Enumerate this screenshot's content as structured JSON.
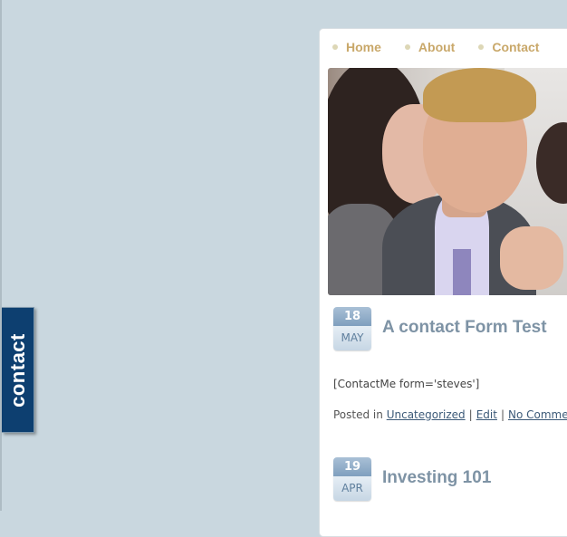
{
  "contact_tab": {
    "label": "contact"
  },
  "nav": {
    "items": [
      {
        "label": "Home"
      },
      {
        "label": "About"
      },
      {
        "label": "Contact"
      }
    ]
  },
  "posts": [
    {
      "day": "18",
      "month": "MAY",
      "title": "A contact Form Test",
      "body": "[ContactMe form='steves']",
      "posted_in": "Posted in",
      "category": "Uncategorized",
      "edit": "Edit",
      "comments": "No Comments"
    },
    {
      "day": "19",
      "month": "APR",
      "title": "Investing 101"
    }
  ],
  "colors": {
    "background": "#c9d7df",
    "tab": "#0d3f70",
    "nav_link": "#c9a86a",
    "title": "#7e93a5"
  }
}
